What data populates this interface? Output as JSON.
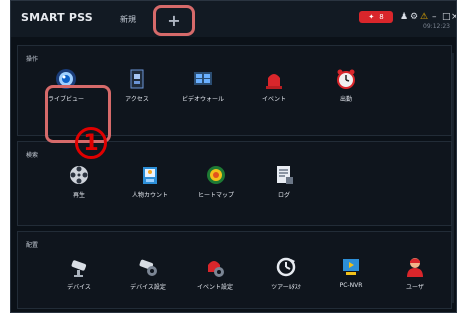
{
  "app": {
    "title": "SMART PSS",
    "time": "09:12:23"
  },
  "tabs": {
    "home": "新規",
    "add": "+"
  },
  "status": {
    "notify_count": "8"
  },
  "sections": {
    "operation": "操作",
    "search": "検索",
    "config": "配置"
  },
  "items": {
    "liveview": "ライブビュー",
    "access": "アクセス",
    "videowall": "ビデオウォール",
    "event": "イベント",
    "attendance": "出勤",
    "playback": "再生",
    "people_count": "人物カウント",
    "heatmap": "ヒートマップ",
    "log": "ログ",
    "device": "デバイス",
    "device_config": "デバイス設定",
    "event_config": "イベント設定",
    "tour_task": "ツアーﾙﾀｽｸ",
    "pc_nvr": "PC-NVR",
    "user": "ユーザ"
  },
  "annotation": {
    "marker": "1"
  }
}
